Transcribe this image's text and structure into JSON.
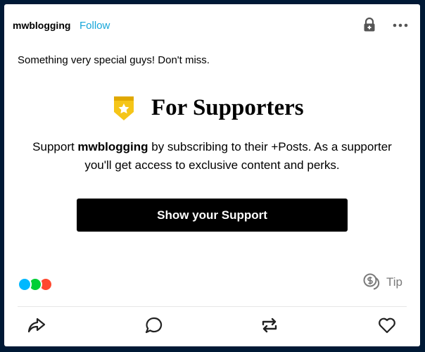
{
  "post": {
    "blog_name": "mwblogging",
    "follow_label": "Follow",
    "caption": "Something very special guys! Don't miss."
  },
  "supporters": {
    "title": "For Supporters",
    "text_prefix": "Support ",
    "text_blog": "mwblogging",
    "text_line1_rest": " by subscribing to their +Posts. As a supporter",
    "text_line2": "you'll get access to exclusive content and perks.",
    "button_label": "Show your Support"
  },
  "footer": {
    "notes_count": "",
    "tip_label": "Tip"
  },
  "colors": {
    "background": "#001935",
    "follow": "#16a6d9",
    "badge": "#f5c518",
    "note_reply": "#00b8ff",
    "note_reblog": "#00cf35",
    "note_like": "#ff492f"
  },
  "icons": [
    "lock-icon",
    "more-icon",
    "supporter-badge-icon",
    "tip-coin-icon",
    "share-icon",
    "reply-icon",
    "reblog-icon",
    "like-icon"
  ]
}
